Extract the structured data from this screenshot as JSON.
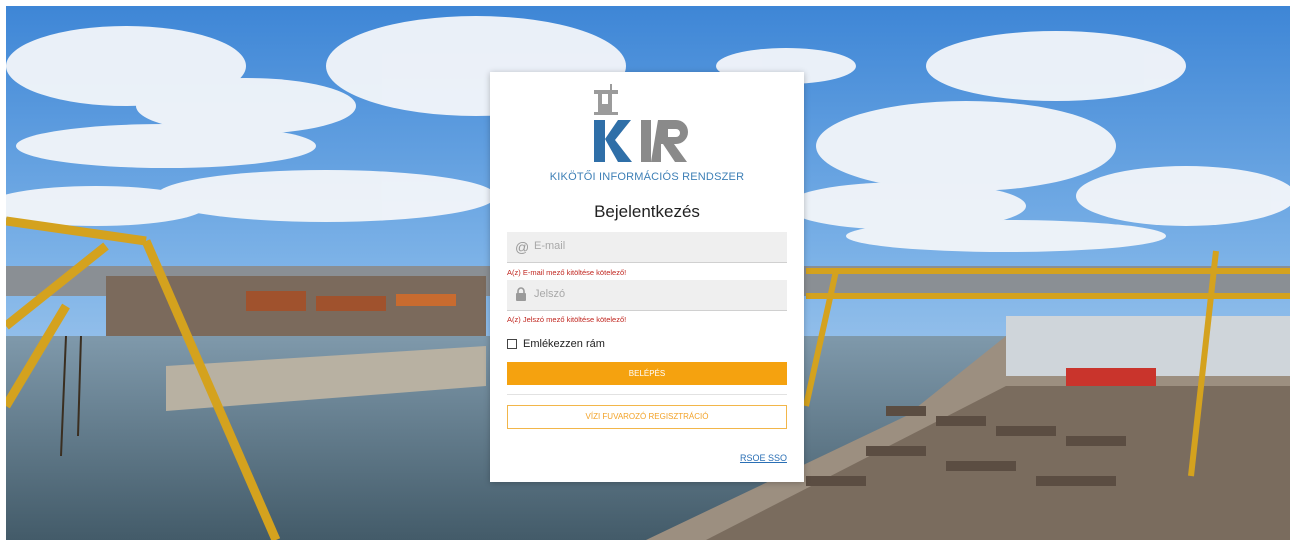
{
  "app": {
    "logo_letters": "KIR",
    "subtitle": "KIKÖTŐI INFORMÁCIÓS RENDSZER"
  },
  "login": {
    "title": "Bejelentkezés",
    "email": {
      "placeholder": "E-mail",
      "value": "",
      "icon": "at-sign-icon",
      "error": "A(z) E-mail mező kitöltése kötelező!"
    },
    "password": {
      "placeholder": "Jelszó",
      "value": "",
      "icon": "lock-icon",
      "error": "A(z) Jelszó mező kitöltése kötelező!"
    },
    "remember_label": "Emlékezzen rám",
    "remember_checked": false,
    "login_button": "BELÉPÉS",
    "register_button": "VÍZI FUVAROZÓ REGISZTRÁCIÓ",
    "sso_link": "RSOE SSO"
  },
  "colors": {
    "accent": "#f5a20f",
    "brand_blue": "#2f6fa8",
    "brand_gray": "#8a8a8a",
    "error": "#c0261f",
    "link": "#2a6fb5"
  }
}
